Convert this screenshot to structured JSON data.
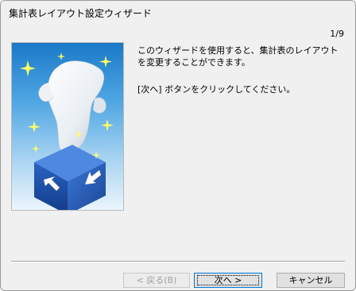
{
  "window": {
    "title": "集計表レイアウト設定ウィザード"
  },
  "page": {
    "indicator": "1/9"
  },
  "content": {
    "description": "このウィザードを使用すると、集計表のレイアウトを変更することができます。",
    "instruction": "[次へ] ボタンをクリックしてください。"
  },
  "buttons": {
    "back": "< 戻る(B)",
    "next": "次へ >",
    "cancel": "キャンセル"
  },
  "image": {
    "icon": "wizard-box-document-icon",
    "colors": {
      "sky_top": "#1a79c8",
      "box_blue": "#1c4fa8",
      "sparkle": "#ffff66"
    }
  }
}
